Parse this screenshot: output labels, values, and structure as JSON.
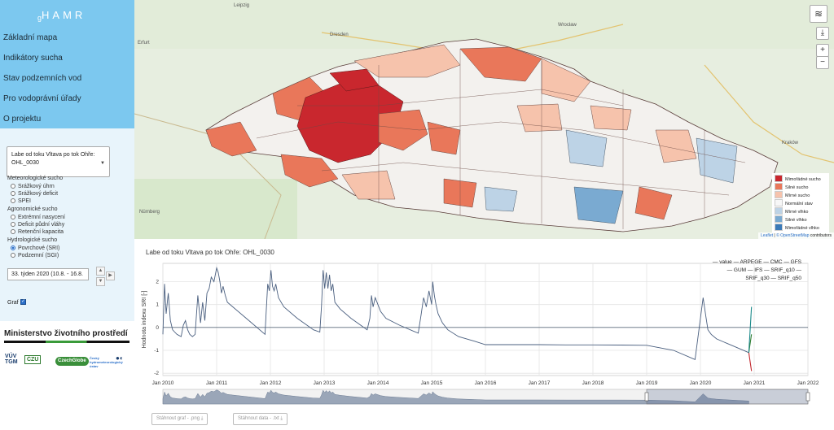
{
  "sidebar": {
    "logo": "HAMR",
    "logo_prefix": "g",
    "nav": [
      {
        "label": "Základní mapa"
      },
      {
        "label": "Indikátory sucha"
      },
      {
        "label": "Stav podzemních vod"
      },
      {
        "label": "Pro vodoprávní úřady"
      },
      {
        "label": "O projektu"
      }
    ],
    "basin_select": "Labe od toku Vltava po tok Ohře: OHL_0030",
    "groups": [
      {
        "label": "Meteorologické sucho",
        "options": [
          {
            "label": "Srážkový úhrn",
            "checked": false
          },
          {
            "label": "Srážkový deficit",
            "checked": false
          },
          {
            "label": "SPEI",
            "checked": false
          }
        ]
      },
      {
        "label": "Agronomické sucho",
        "options": [
          {
            "label": "Extrémní nasycení",
            "checked": false
          },
          {
            "label": "Deficit půdní vláhy",
            "checked": false
          },
          {
            "label": "Retenční kapacita",
            "checked": false
          }
        ]
      },
      {
        "label": "Hydrologické sucho",
        "options": [
          {
            "label": "Povrchové (SRI)",
            "checked": true
          },
          {
            "label": "Podzemní (SGI)",
            "checked": false
          }
        ]
      }
    ],
    "week": "33. týden 2020 (10.8. - 16.8.",
    "graf_label": "Graf",
    "graf_checked": true,
    "ministry": "Ministerstvo životního prostředí",
    "partner_logos": [
      "VÚV TGM",
      "ČZU",
      "CzechGlobe",
      "Český hydrometeorologický ústav",
      "●◐"
    ]
  },
  "map": {
    "cities": [
      "Leipzig",
      "Dresden",
      "Erfurt",
      "Wrocław",
      "Nürnberg",
      "Kraków"
    ],
    "legend": [
      {
        "label": "Mimořádné sucho",
        "color": "#c9272e"
      },
      {
        "label": "Silné sucho",
        "color": "#e9775a"
      },
      {
        "label": "Mírné sucho",
        "color": "#f6c3ac"
      },
      {
        "label": "Normální stav",
        "color": "#f7f7f7"
      },
      {
        "label": "Mírné vlhko",
        "color": "#bdd3e6"
      },
      {
        "label": "Silné vlhko",
        "color": "#7aaad1"
      },
      {
        "label": "Mimořádné vlhko",
        "color": "#3b7ab8"
      }
    ],
    "attribution_leaflet": "Leaflet",
    "attribution_osm": "© OpenStreetMap",
    "attribution_rest": "contributors",
    "buttons": {
      "layers": "≋",
      "download": "⤓",
      "zoom_in": "+",
      "zoom_out": "−"
    }
  },
  "chart": {
    "title": "Labe od toku Vltava po tok Ohře: OHL_0030",
    "download_png": "Stáhnout graf - .png",
    "download_txt": "Stáhnout data - .txt",
    "legend_line1": "— value  — ARPEGE — CMC — GFS",
    "legend_line2": "— GUM — IFS — SRIF_q10 —",
    "legend_line3": "SRIF_q30 — SRIF_q50",
    "colors": {
      "value": "#4a5f7f",
      "ifs": "#c1272d",
      "q10": "#2e7d32",
      "q30": "#8b1a4a",
      "q50": "#1c8a8a"
    }
  },
  "chart_data": {
    "type": "line",
    "title": "Labe od toku Vltava po tok Ohře: OHL_0030",
    "xlabel": "",
    "ylabel": "Hodnota indexu SRI [-]",
    "x_ticks": [
      "Jan 2010",
      "Jan 2011",
      "Jan 2012",
      "Jan 2013",
      "Jan 2014",
      "Jan 2015",
      "Jan 2016",
      "Jan 2017",
      "Jan 2018",
      "Jan 2019",
      "Jan 2020",
      "Jan 2021",
      "Jan 2022"
    ],
    "y_ticks": [
      -2,
      -1,
      0,
      1,
      2
    ],
    "xlim": [
      2010.0,
      2022.0
    ],
    "ylim": [
      -2.1,
      2.8
    ],
    "grid": true,
    "legend": "top-right",
    "series": [
      {
        "name": "value",
        "x": [
          2010.0,
          2010.03,
          2010.06,
          2010.1,
          2010.14,
          2010.18,
          2010.22,
          2010.26,
          2010.3,
          2010.34,
          2010.38,
          2010.42,
          2010.46,
          2010.5,
          2010.55,
          2010.6,
          2010.62,
          2010.65,
          2010.7,
          2010.74,
          2010.78,
          2010.82,
          2010.86,
          2010.9,
          2010.95,
          2011.0,
          2011.03,
          2011.06,
          2011.09,
          2011.12,
          2011.16,
          2011.2,
          2011.3,
          2011.6,
          2011.9,
          2011.92,
          2011.95,
          2011.98,
          2012.01,
          2012.04,
          2012.07,
          2012.1,
          2012.15,
          2012.25,
          2012.5,
          2012.8,
          2012.92,
          2012.95,
          2012.98,
          2013.01,
          2013.04,
          2013.07,
          2013.1,
          2013.13,
          2013.16,
          2013.2,
          2013.3,
          2013.5,
          2013.8,
          2013.85,
          2013.88,
          2013.91,
          2013.95,
          2014.0,
          2014.05,
          2014.15,
          2014.4,
          2014.75,
          2014.8,
          2014.85,
          2014.9,
          2014.95,
          2015.0,
          2015.02,
          2015.05,
          2015.08,
          2015.12,
          2015.2,
          2015.3,
          2015.5,
          2015.8,
          2016.0,
          2016.5,
          2017.0,
          2017.5,
          2018.0,
          2018.5,
          2019.0,
          2019.5,
          2019.9,
          2020.05,
          2020.1,
          2020.14,
          2020.2,
          2020.3,
          2020.5,
          2020.7,
          2020.9
        ],
        "y": [
          -0.3,
          1.9,
          0.6,
          1.5,
          0.3,
          -0.1,
          -0.2,
          -0.3,
          -0.35,
          -0.4,
          0.1,
          0.3,
          -0.1,
          -0.3,
          -0.4,
          -0.3,
          0.4,
          1.4,
          0.2,
          1.1,
          0.3,
          1.5,
          1.7,
          2.2,
          2.0,
          2.6,
          2.4,
          2.0,
          1.5,
          1.8,
          1.4,
          1.1,
          0.9,
          0.3,
          -0.3,
          0.6,
          1.9,
          1.6,
          2.5,
          1.8,
          1.6,
          1.9,
          1.3,
          0.9,
          0.4,
          -0.1,
          -0.2,
          0.9,
          2.5,
          1.7,
          2.4,
          1.7,
          2.3,
          1.6,
          1.9,
          1.1,
          0.8,
          0.4,
          -0.1,
          0.4,
          1.4,
          0.9,
          1.3,
          1.0,
          0.7,
          0.4,
          0.1,
          -0.25,
          0.5,
          1.3,
          0.9,
          1.6,
          1.0,
          2.0,
          1.4,
          1.0,
          0.6,
          0.2,
          -0.1,
          -0.4,
          -0.6,
          -0.75,
          -0.75,
          -0.75,
          -0.76,
          -0.76,
          -0.77,
          -0.78,
          -1.0,
          -1.4,
          1.3,
          0.5,
          -0.1,
          -0.3,
          -0.5,
          -0.7,
          -0.9,
          -1.1
        ]
      },
      {
        "name": "IFS",
        "x": [
          2020.9,
          2020.95
        ],
        "y": [
          -1.1,
          -1.9
        ]
      },
      {
        "name": "SRIF_q10",
        "x": [
          2020.9,
          2020.95
        ],
        "y": [
          -1.1,
          -0.3
        ]
      },
      {
        "name": "SRIF_q50",
        "x": [
          2020.9,
          2020.95
        ],
        "y": [
          -1.1,
          0.9
        ]
      }
    ]
  }
}
